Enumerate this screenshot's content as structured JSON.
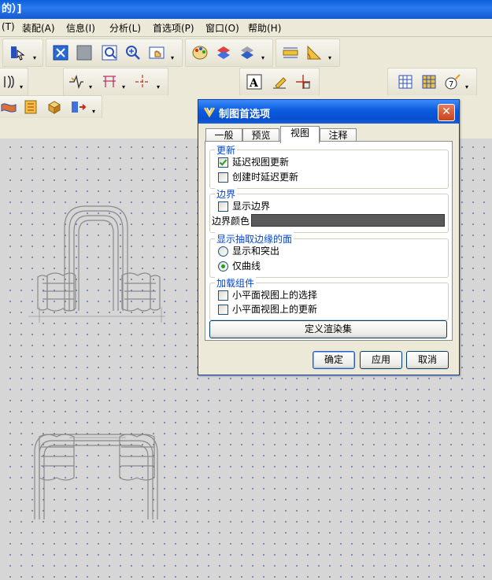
{
  "app": {
    "title_fragment": "的）]"
  },
  "menu": [
    {
      "id": "tools-partial",
      "label": "(T)"
    },
    {
      "id": "assembly",
      "label": "装配(A)"
    },
    {
      "id": "info",
      "label": "信息(I)"
    },
    {
      "id": "analysis",
      "label": "分析(L)"
    },
    {
      "id": "preferences",
      "label": "首选项(P)"
    },
    {
      "id": "window",
      "label": "窗口(O)"
    },
    {
      "id": "help",
      "label": "帮助(H)"
    }
  ],
  "dialog": {
    "title": "制图首选项",
    "close_glyph": "✕",
    "tabs": [
      {
        "label": "一般",
        "active": false
      },
      {
        "label": "预览",
        "active": false
      },
      {
        "label": "视图",
        "active": true
      },
      {
        "label": "注释",
        "active": false
      }
    ],
    "groups": {
      "update": {
        "label": "更新",
        "delay_view_update": {
          "label": "延迟视图更新",
          "checked": true
        },
        "delay_update_on_create": {
          "label": "创建时延迟更新",
          "checked": false
        }
      },
      "border": {
        "label": "边界",
        "show_border": {
          "label": "显示边界",
          "checked": false
        },
        "border_color_label": "边界颜色",
        "border_color": "#5a5a5a"
      },
      "display": {
        "label": "显示抽取边缘的面",
        "show_and_highlight": {
          "label": "显示和突出",
          "selected": false
        },
        "curves_only": {
          "label": "仅曲线",
          "selected": true
        }
      },
      "load": {
        "label": "加载组件",
        "select_on_facet_views": {
          "label": "小平面视图上的选择",
          "checked": false
        },
        "update_on_facet_views": {
          "label": "小平面视图上的更新",
          "checked": false
        }
      }
    },
    "define_render_set_label": "定义渲染集",
    "ok_label": "确定",
    "apply_label": "应用",
    "cancel_label": "取消"
  },
  "colors": {
    "titlebar": "#1559d0",
    "canvas_bg": "#d6d6d6",
    "grid_dots": "#4a5a9a",
    "part_lines": "#8a8a8a",
    "group_label": "#0046d5"
  },
  "toolbar_icons": [
    "snap-icon",
    "fit-view-icon",
    "shaded-view-icon",
    "zoom-icon",
    "zoom-in-icon",
    "pan-icon",
    "color-palette-icon",
    "layer-icon",
    "visibility-icon",
    "measure-distance-icon",
    "protractor-icon",
    "section-view-icon",
    "break-line-icon",
    "table-grid-icon",
    "centerline-icon",
    "text-annotation-icon",
    "leader-pen-icon",
    "datum-icon",
    "hatch-table-icon",
    "grid-table-icon",
    "id-symbol-icon",
    "surface-icon",
    "feature-icon",
    "box-icon",
    "mirror-icon"
  ]
}
